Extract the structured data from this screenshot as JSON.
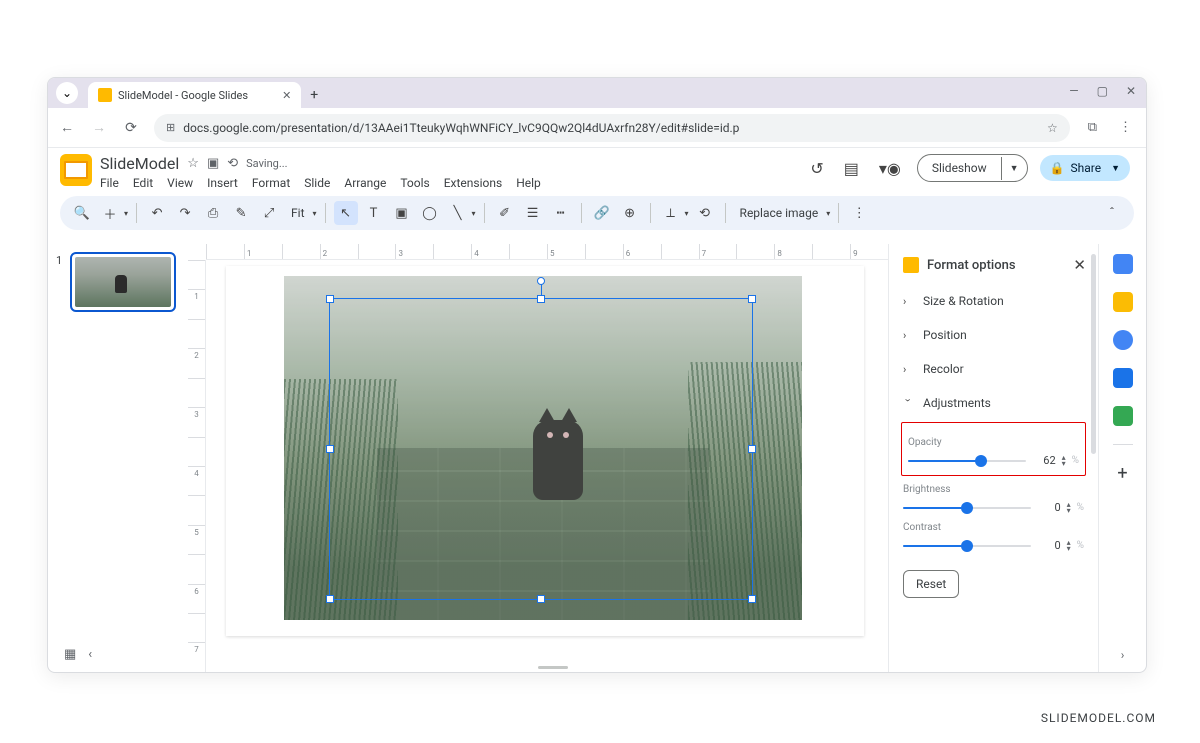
{
  "browser": {
    "tab_title": "SlideModel - Google Slides",
    "url": "docs.google.com/presentation/d/13AAei1TteukyWqhWNFiCY_lvC9QQw2Ql4dUAxrfn28Y/edit#slide=id.p"
  },
  "header": {
    "doc_title": "SlideModel",
    "saving_status": "Saving...",
    "menus": [
      "File",
      "Edit",
      "View",
      "Insert",
      "Format",
      "Slide",
      "Arrange",
      "Tools",
      "Extensions",
      "Help"
    ],
    "slideshow_label": "Slideshow",
    "share_label": "Share"
  },
  "toolbar": {
    "zoom_label": "Fit",
    "replace_image": "Replace image"
  },
  "ruler": {
    "h": [
      "",
      "1",
      "",
      "2",
      "",
      "3",
      "",
      "4",
      "",
      "5",
      "",
      "6",
      "",
      "7",
      "",
      "8",
      "",
      "9"
    ],
    "v": [
      "",
      "1",
      "",
      "2",
      "",
      "3",
      "",
      "4",
      "",
      "5",
      "",
      "6",
      "",
      "7"
    ]
  },
  "slidepanel": {
    "slide_number": "1"
  },
  "sidebar": {
    "title": "Format options",
    "sections": {
      "size_rotation": "Size & Rotation",
      "position": "Position",
      "recolor": "Recolor",
      "adjustments": "Adjustments"
    },
    "adjust": {
      "opacity_label": "Opacity",
      "opacity_value": "62",
      "brightness_label": "Brightness",
      "brightness_value": "0",
      "contrast_label": "Contrast",
      "contrast_value": "0"
    },
    "reset_label": "Reset"
  },
  "watermark": "SLIDEMODEL.COM"
}
